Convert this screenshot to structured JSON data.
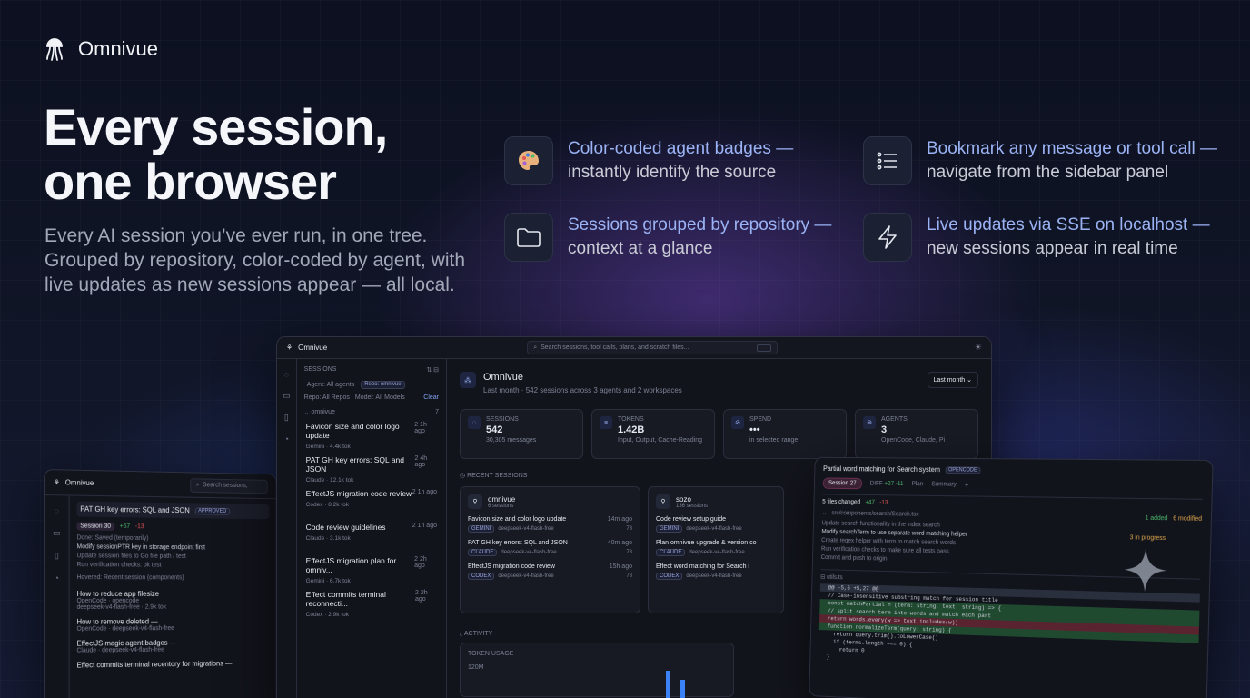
{
  "brand": {
    "name": "Omnivue"
  },
  "hero": {
    "line1": "Every session,",
    "line2": "one browser",
    "subtitle": "Every AI session you’ve ever run, in one tree. Grouped by repository, color-coded by agent, with live updates as new sessions appear — all local."
  },
  "features": [
    {
      "icon": "palette-icon",
      "title": "Color-coded agent badges —",
      "desc": "instantly identify the source"
    },
    {
      "icon": "list-icon",
      "title": "Bookmark any message or tool call —",
      "desc": "navigate from the sidebar panel"
    },
    {
      "icon": "folder-icon",
      "title": "Sessions grouped by repository —",
      "desc": "context at a glance"
    },
    {
      "icon": "bolt-icon",
      "title": "Live updates via SSE on localhost —",
      "desc": "new sessions appear in real time"
    }
  ],
  "main_window": {
    "app": "Omnivue",
    "search_placeholder": "Search sessions, tool calls, plans, and scratch files...",
    "sidebar": {
      "header": "SESSIONS",
      "filter_agent": "Agent: All agents",
      "filter_chip": "Repo: omnivue",
      "filter_repo": "Repo: All Repos",
      "filter_model": "Model: All Models",
      "clear": "Clear",
      "group": "omnivue",
      "group_count": "7",
      "items": [
        {
          "title": "Favicon size and color logo update",
          "meta": "Gemini · 4.4k tok",
          "time": "1h ago",
          "badge": "2"
        },
        {
          "title": "PAT GH key errors: SQL and JSON",
          "meta": "Claude · 12.1k tok",
          "time": "4h ago",
          "badge": "2"
        },
        {
          "title": "EffectJS migration code review",
          "meta": "Codex · 8.2k tok",
          "time": "1h ago",
          "badge": "2"
        },
        {
          "title": "Code review guidelines",
          "meta": "Claude · 3.1k tok",
          "time": "1h ago",
          "badge": "2"
        },
        {
          "title": "EffectJS migration plan for omniv...",
          "meta": "Gemini · 6.7k tok",
          "time": "2h ago",
          "badge": "2"
        },
        {
          "title": "Effect commits terminal reconnecti...",
          "meta": "Codex · 2.9k tok",
          "time": "2h ago",
          "badge": "2"
        }
      ]
    },
    "header": {
      "title": "Omnivue",
      "subtitle": "Last month · 542 sessions across 3 agents and 2 workspaces",
      "range": "Last month"
    },
    "stats": [
      {
        "label": "SESSIONS",
        "value": "542",
        "sub": "30,305 messages"
      },
      {
        "label": "TOKENS",
        "value": "1.42B",
        "sub": "Input, Output, Cache-Reading"
      },
      {
        "label": "SPEND",
        "value": "•••",
        "sub": "in selected range"
      },
      {
        "label": "AGENTS",
        "value": "3",
        "sub": "OpenCode, Claude, Pi"
      }
    ],
    "recent_label": "RECENT SESSIONS",
    "repo_cards": [
      {
        "name": "omnivue",
        "count": "6 sessions",
        "rows": [
          {
            "t": "Favicon size and color logo update",
            "time": "14m ago",
            "tag": "GEMINI",
            "m": "deepseek-v4-flash-free",
            "n": "78"
          },
          {
            "t": "PAT GH key errors: SQL and JSON",
            "time": "40m ago",
            "tag": "CLAUDE",
            "m": "deepseek-v4-flash-free",
            "n": "78"
          },
          {
            "t": "EffectJS migration code review",
            "time": "15h ago",
            "tag": "CODEX",
            "m": "deepseek-v4-flash-free",
            "n": "78"
          }
        ]
      },
      {
        "name": "sozo",
        "count": "136 sessions",
        "rows": [
          {
            "t": "Code review setup guide",
            "time": "",
            "tag": "GEMINI",
            "m": "deepseek-v4-flash-free",
            "n": ""
          },
          {
            "t": "Plan omnivue upgrade & version co",
            "time": "",
            "tag": "CLAUDE",
            "m": "deepseek-v4-flash-free",
            "n": ""
          },
          {
            "t": "Effect word matching for Search i",
            "time": "",
            "tag": "CODEX",
            "m": "deepseek-v4-flash-free",
            "n": ""
          }
        ]
      }
    ],
    "activity_label": "ACTIVITY",
    "token_usage": "TOKEN USAGE",
    "token_axis": "120M"
  },
  "left_window": {
    "app": "Omnivue",
    "search": "Search sessions,",
    "title": "PAT GH key errors: SQL and JSON",
    "tag": "APPROVED",
    "session": "Session 30",
    "diff_plus": "+67",
    "diff_minus": "-13",
    "checklist": [
      "Done: Saved (temporarily)",
      "Modify sessionPTR key in storage endpoint first",
      "Update session files to Go file path / test",
      "Run verification checks: ok test"
    ],
    "collapsed": "Hovered: Recent session (components)",
    "items": [
      {
        "t": "How to reduce app filesize",
        "m": "OpenCode · opencode\ndeepseek-v4-flash-free · 2.9k tok"
      },
      {
        "t": "How to remove deleted —",
        "m": "OpenCode · deepseek-v4-flash-free"
      },
      {
        "t": "EffectJS magic agent badges —",
        "m": "Claude · deepseek-v4-flash-free"
      },
      {
        "t": "Effect commits terminal recentory for migrations —",
        "m": ""
      }
    ]
  },
  "right_window": {
    "title": "Partial word matching for Search system",
    "tag": "OPENCODE",
    "tab_session": "Session 27",
    "tab_diff": "DIFF",
    "diff_counts": "+27 -11",
    "tab_plan": "Plan",
    "tab_summary": "Summary",
    "files": "5 files changed",
    "plus": "+47",
    "minus": "-13",
    "file": "src/components/search/Search.tsx",
    "status1": "1 added",
    "status2": "6 modified",
    "checks": [
      "Update search functionality in the index search",
      "Modify searchTerm to use separate word matching helper",
      "Create regex helper with term to match search words",
      "Run verification checks to make sure all tests pass",
      "Commit and push to origin"
    ],
    "progress": "3 in progress",
    "code_header": "utils.ts",
    "code": [
      "@@ -5,6 +5,27 @@",
      "// Case-insensitive substring match for session title",
      "const matchPartial = (term: string, text: string) => {",
      "// split search term into words and match each part",
      "return words.every(w => text.includes(w))",
      "function normalizeTerm(query: string) {",
      "  return query.trim().toLowerCase()",
      "  if (terms.length === 0) {",
      "    return 0",
      "}"
    ]
  }
}
